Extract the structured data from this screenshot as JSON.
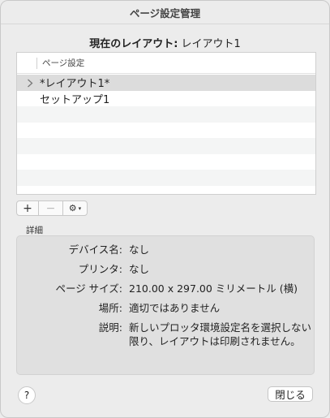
{
  "window": {
    "title": "ページ設定管理"
  },
  "current": {
    "label": "現在のレイアウト:",
    "value": "レイアウト1"
  },
  "list": {
    "header": "ページ設定",
    "items": [
      {
        "label": "*レイアウト1*",
        "selected": true,
        "expandable": true
      },
      {
        "label": "セットアップ1",
        "selected": false,
        "expandable": false
      }
    ]
  },
  "toolbar": {
    "add": "+",
    "remove": "−",
    "gear": "⚙",
    "caret": "▾"
  },
  "details": {
    "title": "詳細",
    "rows": [
      {
        "key": "デバイス名:",
        "value": "なし"
      },
      {
        "key": "プリンタ:",
        "value": "なし"
      },
      {
        "key": "ページ サイズ:",
        "value": "210.00 x 297.00 ミリメートル (横)"
      },
      {
        "key": "場所:",
        "value": "適切ではありません"
      },
      {
        "key": "説明:",
        "value": "新しいプロッタ環境設定名を選択しない",
        "value2": "限り、レイアウトは印刷されません。"
      }
    ]
  },
  "footer": {
    "help": "?",
    "close": "閉じる"
  }
}
